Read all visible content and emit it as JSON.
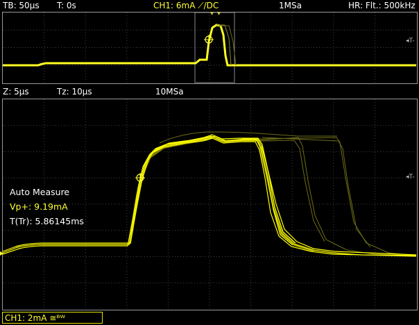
{
  "top_bar": {
    "timebase": "TB: 50µs",
    "trigger_time": "T: 0s",
    "channel": "CH1: 6mA ⟋/DC",
    "sample_rate": "1MSa",
    "hr_filter": "HR: Flt.: 500kHz"
  },
  "zoom_bar": {
    "zoom": "Z: 5µs",
    "tz": "Tz: 10µs",
    "sample_rate": "10MSa"
  },
  "measurement": {
    "title": "Auto Measure",
    "vp": "Vp+: 9.19mA",
    "tr": "T(Tr): 5.86145ms"
  },
  "channel_box": {
    "label": "CH1: 2mA ≅ᴮᵂ"
  },
  "trigger_marker": "◂T-",
  "colors": {
    "trace": "#ffff00",
    "trace_dim": "#6b6b10",
    "grid": "#444444",
    "border": "#9a9a9a"
  }
}
